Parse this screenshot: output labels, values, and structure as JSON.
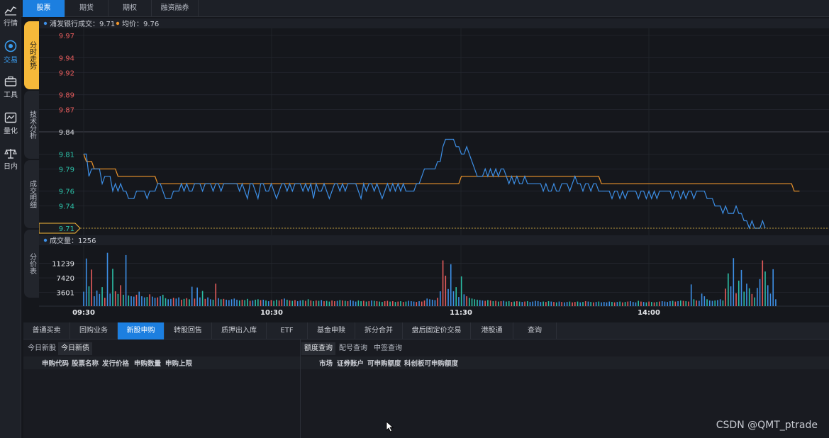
{
  "sidebar": {
    "items": [
      {
        "label": "行情",
        "icon": "market-chart-icon",
        "active": false
      },
      {
        "label": "交易",
        "icon": "trade-target-icon",
        "active": true
      },
      {
        "label": "工具",
        "icon": "toolbox-icon",
        "active": false
      },
      {
        "label": "量化",
        "icon": "quant-icon",
        "active": false
      },
      {
        "label": "日内",
        "icon": "intraday-scale-icon",
        "active": false
      }
    ]
  },
  "top_tabs": [
    {
      "label": "股票",
      "active": true
    },
    {
      "label": "期货",
      "active": false
    },
    {
      "label": "期权",
      "active": false
    },
    {
      "label": "融资融券",
      "active": false
    }
  ],
  "side_tabs": [
    {
      "label": "分时走势",
      "active": true
    },
    {
      "label": "技术分析",
      "active": false
    },
    {
      "label": "成交明细",
      "active": false
    },
    {
      "label": "分价表",
      "active": false
    }
  ],
  "price_legend": {
    "stock_name": "浦发银行",
    "trade_text": "成交：9.71",
    "avg_text": "均价：9.76"
  },
  "volume_legend": {
    "text": "成交量：1256"
  },
  "current_price_label": "9.71",
  "chart_data": {
    "type": "line",
    "price_axis": {
      "ticks": [
        "9.97",
        "9.94",
        "9.92",
        "9.89",
        "9.87",
        "9.84",
        "9.81",
        "9.79",
        "9.76",
        "9.74",
        "9.71"
      ],
      "ylim": [
        9.71,
        9.97
      ],
      "ref_price": 9.84
    },
    "volume_axis": {
      "ticks": [
        "11239",
        "7420",
        "3601"
      ],
      "ylim": [
        0,
        14500
      ]
    },
    "x_ticks": [
      "09:30",
      "10:30",
      "11:30",
      "14:00"
    ],
    "series": [
      {
        "role": "price",
        "color": "#3d8fe6",
        "values": [
          9.81,
          9.81,
          9.78,
          9.79,
          9.79,
          9.79,
          9.79,
          9.77,
          9.78,
          9.78,
          9.78,
          9.76,
          9.77,
          9.76,
          9.77,
          9.76,
          9.76,
          9.75,
          9.75,
          9.75,
          9.76,
          9.76,
          9.76,
          9.76,
          9.75,
          9.76,
          9.76,
          9.76,
          9.77,
          9.77,
          9.76,
          9.75,
          9.75,
          9.75,
          9.76,
          9.76,
          9.76,
          9.77,
          9.76,
          9.77,
          9.76,
          9.76,
          9.77,
          9.77,
          9.77,
          9.76,
          9.77,
          9.77,
          9.77,
          9.76,
          9.77,
          9.77,
          9.76,
          9.77,
          9.77,
          9.77,
          9.77,
          9.77,
          9.77,
          9.76,
          9.77,
          9.76,
          9.75,
          9.77,
          9.77,
          9.76,
          9.75,
          9.77,
          9.77,
          9.76,
          9.76,
          9.77,
          9.76,
          9.75,
          9.76,
          9.77,
          9.77,
          9.76,
          9.77,
          9.76,
          9.77,
          9.77,
          9.77,
          9.76,
          9.77,
          9.76,
          9.77,
          9.75,
          9.77,
          9.76,
          9.76,
          9.77,
          9.76,
          9.75,
          9.76,
          9.77,
          9.77,
          9.76,
          9.77,
          9.76,
          9.77,
          9.77,
          9.77,
          9.77,
          9.76,
          9.75,
          9.77,
          9.76,
          9.77,
          9.77,
          9.76,
          9.77,
          9.76,
          9.75,
          9.76,
          9.77,
          9.76,
          9.77,
          9.76,
          9.77,
          9.76,
          9.77,
          9.76,
          9.76,
          9.76,
          9.76,
          9.77,
          9.77,
          9.78,
          9.79,
          9.79,
          9.79,
          9.79,
          9.79,
          9.8,
          9.8,
          9.82,
          9.83,
          9.83,
          9.83,
          9.83,
          9.82,
          9.82,
          9.81,
          9.81,
          9.82,
          9.81,
          9.8,
          9.79,
          9.78,
          9.78,
          9.78,
          9.79,
          9.78,
          9.79,
          9.78,
          9.79,
          9.78,
          9.79,
          9.79,
          9.78,
          9.77,
          9.78,
          9.77,
          9.78,
          9.77,
          9.77,
          9.78,
          9.77,
          9.77,
          9.77,
          9.77,
          9.77,
          9.77,
          9.76,
          9.77,
          9.76,
          9.76,
          9.77,
          9.76,
          9.76,
          9.77,
          9.77,
          9.77,
          9.76,
          9.77,
          9.78,
          9.77,
          9.77,
          9.76,
          9.77,
          9.77,
          9.76,
          9.77,
          9.77,
          9.76,
          9.76,
          9.76,
          9.76,
          9.76,
          9.75,
          9.76,
          9.76,
          9.75,
          9.76,
          9.75,
          9.76,
          9.76,
          9.76,
          9.76,
          9.75,
          9.76,
          9.76,
          9.75,
          9.76,
          9.75,
          9.76,
          9.75,
          9.76,
          9.76,
          9.76,
          9.76,
          9.76,
          9.75,
          9.76,
          9.76,
          9.75,
          9.76,
          9.75,
          9.76,
          9.76,
          9.75,
          9.76,
          9.76,
          9.76,
          9.76,
          9.75,
          9.75,
          9.75,
          9.74,
          9.74,
          9.74,
          9.73,
          9.74,
          9.73,
          9.73,
          9.73,
          9.74,
          9.73,
          9.73,
          9.72,
          9.72,
          9.71,
          9.72,
          9.71,
          9.71,
          9.71,
          9.72,
          9.71
        ]
      },
      {
        "role": "average",
        "color": "#f0962b",
        "values": [
          9.81,
          9.8,
          9.8,
          9.8,
          9.79,
          9.79,
          9.79,
          9.79,
          9.79,
          9.79,
          9.79,
          9.79,
          9.79,
          9.78,
          9.78,
          9.78,
          9.78,
          9.78,
          9.78,
          9.78,
          9.78,
          9.78,
          9.78,
          9.78,
          9.78,
          9.78,
          9.78,
          9.78,
          9.77,
          9.77,
          9.77,
          9.77,
          9.77,
          9.77,
          9.77,
          9.77,
          9.77,
          9.77,
          9.77,
          9.77,
          9.77,
          9.77,
          9.77,
          9.77,
          9.77,
          9.77,
          9.77,
          9.77,
          9.77,
          9.77,
          9.77,
          9.77,
          9.77,
          9.77,
          9.77,
          9.77,
          9.77,
          9.77,
          9.77,
          9.77,
          9.77,
          9.77,
          9.77,
          9.77,
          9.77,
          9.77,
          9.77,
          9.77,
          9.77,
          9.77,
          9.77,
          9.77,
          9.77,
          9.77,
          9.77,
          9.77,
          9.77,
          9.77,
          9.77,
          9.77,
          9.77,
          9.77,
          9.77,
          9.77,
          9.77,
          9.77,
          9.77,
          9.77,
          9.77,
          9.77,
          9.77,
          9.77,
          9.77,
          9.77,
          9.77,
          9.77,
          9.77,
          9.77,
          9.77,
          9.77,
          9.77,
          9.77,
          9.77,
          9.77,
          9.77,
          9.77,
          9.77,
          9.77,
          9.77,
          9.77,
          9.77,
          9.77,
          9.77,
          9.77,
          9.77,
          9.77,
          9.77,
          9.77,
          9.77,
          9.77,
          9.77,
          9.77,
          9.77,
          9.77,
          9.77,
          9.77,
          9.77,
          9.77,
          9.77,
          9.77,
          9.77,
          9.77,
          9.77,
          9.77,
          9.77,
          9.77,
          9.77,
          9.77,
          9.77,
          9.77,
          9.77,
          9.77,
          9.77,
          9.78,
          9.78,
          9.78,
          9.78,
          9.78,
          9.78,
          9.78,
          9.78,
          9.78,
          9.78,
          9.78,
          9.78,
          9.78,
          9.78,
          9.78,
          9.78,
          9.78,
          9.78,
          9.78,
          9.78,
          9.78,
          9.78,
          9.78,
          9.78,
          9.78,
          9.78,
          9.78,
          9.78,
          9.78,
          9.78,
          9.78,
          9.78,
          9.78,
          9.78,
          9.78,
          9.78,
          9.78,
          9.78,
          9.78,
          9.78,
          9.78,
          9.78,
          9.78,
          9.78,
          9.78,
          9.78,
          9.78,
          9.78,
          9.78,
          9.78,
          9.78,
          9.78,
          9.78,
          9.77,
          9.77,
          9.77,
          9.77,
          9.77,
          9.77,
          9.77,
          9.77,
          9.77,
          9.77,
          9.77,
          9.77,
          9.77,
          9.77,
          9.77,
          9.77,
          9.77,
          9.77,
          9.77,
          9.77,
          9.77,
          9.77,
          9.77,
          9.77,
          9.77,
          9.77,
          9.77,
          9.77,
          9.77,
          9.77,
          9.77,
          9.77,
          9.77,
          9.77,
          9.77,
          9.77,
          9.77,
          9.77,
          9.77,
          9.77,
          9.77,
          9.77,
          9.77,
          9.77,
          9.77,
          9.77,
          9.77,
          9.77,
          9.77,
          9.77,
          9.77,
          9.77,
          9.77,
          9.77,
          9.77,
          9.77,
          9.77,
          9.77,
          9.77,
          9.77,
          9.77,
          9.77,
          9.77,
          9.77,
          9.77,
          9.77,
          9.77,
          9.77,
          9.77,
          9.77,
          9.77,
          9.77,
          9.77,
          9.76,
          9.76,
          9.76
        ]
      }
    ],
    "volume": {
      "values": [
        3800,
        12500,
        5200,
        9600,
        2600,
        4100,
        3200,
        5000,
        2200,
        14000,
        3300,
        9800,
        3900,
        3200,
        5500,
        3000,
        13400,
        2800,
        2600,
        2500,
        3000,
        3800,
        2600,
        2300,
        2400,
        3100,
        2500,
        2200,
        2300,
        2600,
        3000,
        2100,
        1800,
        1900,
        2200,
        2000,
        2300,
        1700,
        1900,
        2100,
        1800,
        5100,
        2000,
        4900,
        2300,
        4000,
        1900,
        2300,
        1800,
        1700,
        5900,
        2100,
        1800,
        1900,
        1700,
        1600,
        1800,
        2000,
        1700,
        1500,
        1700,
        1600,
        1900,
        1400,
        1500,
        1700,
        1800,
        1600,
        1700,
        1500,
        1300,
        1600,
        1400,
        1700,
        1500,
        1800,
        2000,
        1700,
        1500,
        1400,
        1600,
        1300,
        1500,
        1600,
        1400,
        1800,
        1500,
        1300,
        1500,
        1400,
        1600,
        1300,
        1400,
        1200,
        1500,
        1300,
        1400,
        1600,
        1500,
        1400,
        1300,
        1600,
        1400,
        1200,
        1500,
        1300,
        1400,
        1200,
        1300,
        1500,
        1400,
        1300,
        1200,
        1100,
        1300,
        1400,
        1200,
        1300,
        1100,
        1200,
        1300,
        1100,
        1200,
        1400,
        1300,
        1200,
        1100,
        1300,
        1200,
        1500,
        2000,
        1800,
        1700,
        1600,
        2200,
        3900,
        12000,
        8000,
        4500,
        11000,
        3900,
        5000,
        2400,
        7800,
        3100,
        2600,
        2200,
        2000,
        1800,
        1700,
        1600,
        1500,
        1400,
        1600,
        1500,
        1300,
        1400,
        1200,
        1300,
        1400,
        1200,
        1300,
        1100,
        1200,
        1300,
        1200,
        1100,
        1200,
        1300,
        1100,
        1200,
        1400,
        1300,
        1100,
        1200,
        1100,
        1300,
        1200,
        1100,
        1000,
        1200,
        1100,
        1000,
        1100,
        1200,
        1000,
        1100,
        1200,
        1000,
        1100,
        1300,
        1200,
        1100,
        1000,
        1100,
        1200,
        1000,
        1100,
        1000,
        1200,
        1100,
        1000,
        1100,
        1200,
        1000,
        1100,
        1200,
        1300,
        1100,
        1000,
        1400,
        1200,
        1100,
        1000,
        1200,
        1100,
        1000,
        1100,
        1200,
        1300,
        1200,
        1100,
        1300,
        1400,
        1200,
        1300,
        1500,
        1400,
        1300,
        1200,
        5700,
        1800,
        1500,
        1400,
        3300,
        2600,
        1800,
        1500,
        1400,
        1500,
        1600,
        1800,
        1500,
        4600,
        8600,
        5200,
        12600,
        3400,
        6700,
        9500,
        3800,
        5900,
        4700,
        3200,
        2300,
        4800,
        7100,
        12000,
        9100,
        5500,
        3300,
        9700,
        1800
      ]
    }
  },
  "bottom_tabs": [
    {
      "label": "普通买卖",
      "active": false
    },
    {
      "label": "回购业务",
      "active": false
    },
    {
      "label": "新股申购",
      "active": true
    },
    {
      "label": "转股回售",
      "active": false
    },
    {
      "label": "质押出入库",
      "active": false
    },
    {
      "label": "ETF",
      "active": false
    },
    {
      "label": "基金申赎",
      "active": false
    },
    {
      "label": "拆分合并",
      "active": false
    },
    {
      "label": "盘后固定价交易",
      "active": false
    },
    {
      "label": "港股通",
      "active": false
    },
    {
      "label": "查询",
      "active": false
    }
  ],
  "left_panel": {
    "tabs": [
      {
        "label": "今日新股",
        "active": false
      },
      {
        "label": "今日新债",
        "active": true
      }
    ],
    "columns": [
      "申购代码",
      "股票名称",
      "发行价格",
      "申购数量",
      "申购上限"
    ]
  },
  "right_panel": {
    "tabs": [
      {
        "label": "额度查询",
        "active": true
      },
      {
        "label": "配号查询",
        "active": false
      },
      {
        "label": "中签查询",
        "active": false
      }
    ],
    "columns": [
      "市场",
      "证券账户",
      "可申购额度",
      "科创板可申购额度"
    ]
  },
  "watermark": "CSDN @QMT_ptrade",
  "colors": {
    "accent": "#1c7fe0",
    "active_side_tab": "#f6b93a",
    "up": "#e45b5b",
    "down": "#2bbfa6",
    "ref": "#d7d9de"
  }
}
